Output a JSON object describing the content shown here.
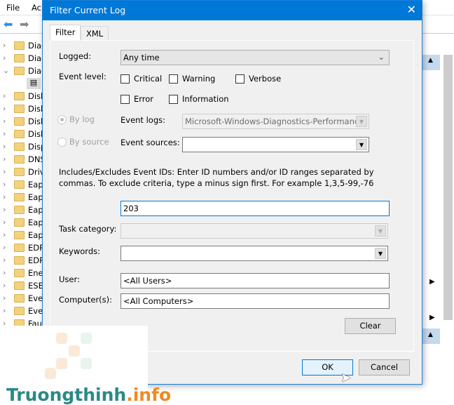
{
  "background": {
    "menu": [
      "File",
      "Ac"
    ],
    "tree": [
      {
        "label": "Diag",
        "state": "collapsed"
      },
      {
        "label": "Diag",
        "state": "collapsed"
      },
      {
        "label": "Diag",
        "state": "expanded"
      },
      {
        "label": "",
        "state": "child"
      },
      {
        "label": "Disk",
        "state": "collapsed"
      },
      {
        "label": "Disk",
        "state": "collapsed"
      },
      {
        "label": "Disk",
        "state": "collapsed"
      },
      {
        "label": "Disk",
        "state": "collapsed"
      },
      {
        "label": "Disp",
        "state": "collapsed"
      },
      {
        "label": "DNS",
        "state": "collapsed"
      },
      {
        "label": "Driv",
        "state": "collapsed"
      },
      {
        "label": "Eap",
        "state": "collapsed"
      },
      {
        "label": "Eap",
        "state": "collapsed"
      },
      {
        "label": "Eap",
        "state": "collapsed"
      },
      {
        "label": "Eap",
        "state": "collapsed"
      },
      {
        "label": "Eap",
        "state": "collapsed"
      },
      {
        "label": "EDP",
        "state": "collapsed"
      },
      {
        "label": "EDP",
        "state": "collapsed"
      },
      {
        "label": "Ene",
        "state": "collapsed"
      },
      {
        "label": "ESE",
        "state": "collapsed"
      },
      {
        "label": "Eve",
        "state": "collapsed"
      },
      {
        "label": "Eve",
        "state": "collapsed"
      },
      {
        "label": "Fau",
        "state": "collapsed"
      }
    ]
  },
  "dialog": {
    "title": "Filter Current Log",
    "close": "✕",
    "tabs": [
      "Filter",
      "XML"
    ],
    "logged_label": "Logged:",
    "logged_value": "Any time",
    "event_level_label": "Event level:",
    "levels": [
      "Critical",
      "Warning",
      "Verbose",
      "Error",
      "Information"
    ],
    "by_log": "By log",
    "by_source": "By source",
    "event_logs_label": "Event logs:",
    "event_logs_value": "Microsoft-Windows-Diagnostics-Performance/",
    "event_sources_label": "Event sources:",
    "event_sources_value": "",
    "ids_help": "Includes/Excludes Event IDs: Enter ID numbers and/or ID ranges separated by commas. To exclude criteria, type a minus sign first. For example 1,3,5-99,-76",
    "ids_value": "203",
    "task_category_label": "Task category:",
    "keywords_label": "Keywords:",
    "user_label": "User:",
    "user_value": "<All Users>",
    "computer_label": "Computer(s):",
    "computer_value": "<All Computers>",
    "clear": "Clear",
    "ok": "OK",
    "cancel": "Cancel"
  },
  "watermark": {
    "text_main": "Truongthinh",
    "text_suffix": ".info"
  },
  "colors": {
    "accent": "#0078d7",
    "watermark_teal": "#2a8a86",
    "watermark_orange": "#f08a24"
  }
}
